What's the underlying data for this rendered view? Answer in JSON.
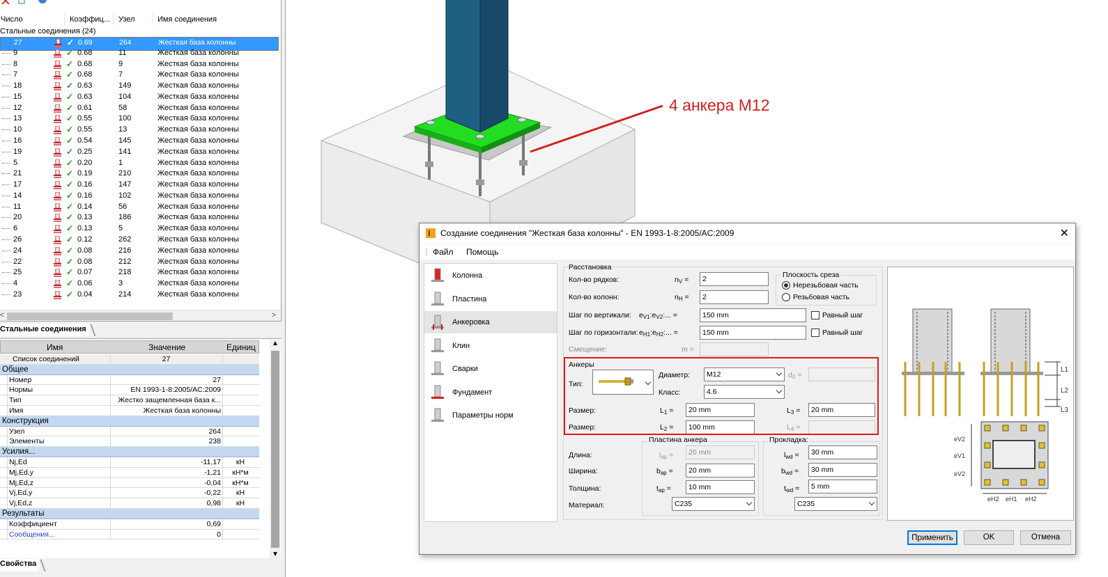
{
  "tree": {
    "headers": [
      "Число",
      "Коэффиц...",
      "Узел",
      "Имя соединения"
    ],
    "group": "Стальные соединения (24)",
    "rows": [
      {
        "n": "27",
        "k": "0.69",
        "u": "264",
        "name": "Жесткая база колонны"
      },
      {
        "n": "9",
        "k": "0.68",
        "u": "11",
        "name": "Жесткая база колонны"
      },
      {
        "n": "8",
        "k": "0.68",
        "u": "9",
        "name": "Жесткая база колонны"
      },
      {
        "n": "7",
        "k": "0.68",
        "u": "7",
        "name": "Жесткая база колонны"
      },
      {
        "n": "18",
        "k": "0.63",
        "u": "149",
        "name": "Жесткая база колонны"
      },
      {
        "n": "15",
        "k": "0.63",
        "u": "104",
        "name": "Жесткая база колонны"
      },
      {
        "n": "12",
        "k": "0.61",
        "u": "58",
        "name": "Жесткая база колонны"
      },
      {
        "n": "13",
        "k": "0.55",
        "u": "100",
        "name": "Жесткая база колонны"
      },
      {
        "n": "10",
        "k": "0.55",
        "u": "13",
        "name": "Жесткая база колонны"
      },
      {
        "n": "16",
        "k": "0.54",
        "u": "145",
        "name": "Жесткая база колонны"
      },
      {
        "n": "19",
        "k": "0.25",
        "u": "141",
        "name": "Жесткая база колонны"
      },
      {
        "n": "5",
        "k": "0.20",
        "u": "1",
        "name": "Жесткая база колонны"
      },
      {
        "n": "21",
        "k": "0.19",
        "u": "210",
        "name": "Жесткая база колонны"
      },
      {
        "n": "17",
        "k": "0.16",
        "u": "147",
        "name": "Жесткая база колонны"
      },
      {
        "n": "14",
        "k": "0.16",
        "u": "102",
        "name": "Жесткая база колонны"
      },
      {
        "n": "11",
        "k": "0.14",
        "u": "56",
        "name": "Жесткая база колонны"
      },
      {
        "n": "20",
        "k": "0.13",
        "u": "186",
        "name": "Жесткая база колонны"
      },
      {
        "n": "6",
        "k": "0.13",
        "u": "5",
        "name": "Жесткая база колонны"
      },
      {
        "n": "26",
        "k": "0.12",
        "u": "262",
        "name": "Жесткая база колонны"
      },
      {
        "n": "24",
        "k": "0.08",
        "u": "216",
        "name": "Жесткая база колонны"
      },
      {
        "n": "22",
        "k": "0.08",
        "u": "212",
        "name": "Жесткая база колонны"
      },
      {
        "n": "25",
        "k": "0.07",
        "u": "218",
        "name": "Жесткая база колонны"
      },
      {
        "n": "4",
        "k": "0.06",
        "u": "3",
        "name": "Жесткая база колонны"
      },
      {
        "n": "23",
        "k": "0.04",
        "u": "214",
        "name": "Жесткая база колонны"
      }
    ],
    "tab": "Стальные соединения"
  },
  "props": {
    "headers": [
      "Имя",
      "Значение",
      "Единиц"
    ],
    "rows": [
      {
        "cat": false,
        "a": "Список соединений",
        "b": "27",
        "c": "",
        "top": true
      },
      {
        "cat": true,
        "a": "Общее"
      },
      {
        "a": "Номер",
        "b": "27",
        "c": ""
      },
      {
        "a": "Нормы",
        "b": "EN 1993-1-8:2005/AC:2009",
        "c": ""
      },
      {
        "a": "Тип",
        "b": "Жестко защемленная база к...",
        "c": ""
      },
      {
        "a": "Имя",
        "b": "Жесткая база колонны",
        "c": ""
      },
      {
        "cat": true,
        "a": "Конструкция"
      },
      {
        "a": "Узел",
        "b": "264",
        "c": ""
      },
      {
        "a": "Элементы",
        "b": "238",
        "c": ""
      },
      {
        "cat": true,
        "a": "Усилия..."
      },
      {
        "a": "Nj,Ed",
        "b": "-11,17",
        "c": "кН"
      },
      {
        "a": "Mj,Ed,y",
        "b": "-1,21",
        "c": "кН*м"
      },
      {
        "a": "Mj,Ed,z",
        "b": "-0,04",
        "c": "кН*м"
      },
      {
        "a": "Vj,Ed,y",
        "b": "-0,22",
        "c": "кН"
      },
      {
        "a": "Vj,Ed,z",
        "b": "0,98",
        "c": "кН"
      },
      {
        "cat": true,
        "a": "Результаты"
      },
      {
        "a": "Коэффициент",
        "b": "0,69",
        "c": ""
      },
      {
        "a": "Сообщения...",
        "b": "0",
        "c": "",
        "link": true
      }
    ],
    "tab": "Свойства"
  },
  "callout": "4 анкера M12",
  "dialog": {
    "title": "Создание соединения \"Жесткая база колонны\" - EN 1993-1-8:2005/AC:2009",
    "menu": [
      "Файл",
      "Помощь"
    ],
    "nav": [
      "Колонна",
      "Пластина",
      "Анкеровка",
      "Клин",
      "Сварки",
      "Фундамент",
      "Параметры норм"
    ],
    "placement": {
      "title": "Расстановка",
      "rows_label": "Кол-во рядков:",
      "rows_sym": "n",
      "rows_sub": "V",
      "rows_val": "2",
      "cols_label": "Кол-во колонн:",
      "cols_sym": "n",
      "cols_sub": "H",
      "cols_val": "2",
      "vstep_label": "Шаг по вертикали:",
      "vstep_sym": "e",
      "vstep_sub1": "V1",
      "vstep_sep": ":e",
      "vstep_sub2": "V2",
      "vstep_tail": ":...",
      "vstep_val": "150 mm",
      "hstep_label": "Шаг по горизонтали:",
      "hstep_sym": "e",
      "hstep_sub1": "H1",
      "hstep_sep": ":e",
      "hstep_sub2": "H2",
      "hstep_tail": ":...",
      "hstep_val": "150 mm",
      "eq": "Равный шаг",
      "offset_label": "Смещение:",
      "offset_sym": "m"
    },
    "shear": {
      "title": "Плоскость среза",
      "opt1": "Нерезьбовая часть",
      "opt2": "Резьбовая часть"
    },
    "anchors": {
      "title": "Анкеры",
      "type_label": "Тип:",
      "diam_label": "Диаметр:",
      "diam_val": "M12",
      "d0": "d",
      "d0_sub": "0",
      "class_label": "Класс:",
      "class_val": "4.6",
      "size_label": "Размер:",
      "L": "L",
      "L1_sub": "1",
      "L1_val": "20 mm",
      "L2_sub": "2",
      "L2_val": "100 mm",
      "L3_sub": "3",
      "L3_val": "20 mm",
      "L4_sub": "4"
    },
    "plate": {
      "title": "Пластина анкера",
      "len_label": "Длина:",
      "len_sym": "l",
      "len_sub": "ap",
      "len_val": "20 mm",
      "w_label": "Ширина:",
      "w_sym": "b",
      "w_sub": "ap",
      "w_val": "20 mm",
      "t_label": "Толщина:",
      "t_sym": "t",
      "t_sub": "ap",
      "t_val": "10 mm",
      "mat_label": "Материал:",
      "mat_val": "C235"
    },
    "washer": {
      "title": "Прокладка:",
      "l_sym": "l",
      "l_sub": "wd",
      "l_val": "30 mm",
      "b_sym": "b",
      "b_sub": "wd",
      "b_val": "30 mm",
      "t_sym": "t",
      "t_sub": "wd",
      "t_val": "5 mm",
      "mat_val": "C235"
    },
    "buttons": [
      "Применить",
      "OK",
      "Отмена"
    ],
    "diagram": {
      "L1": "L1",
      "L2": "L2",
      "L3": "L3",
      "eV2": "eV2",
      "eV1": "eV1",
      "eV2b": "eV2",
      "eH2": "eH2",
      "eH1": "eH1",
      "eH2b": "eH2"
    }
  }
}
